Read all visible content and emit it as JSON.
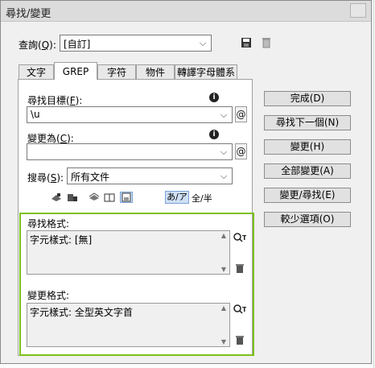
{
  "dialog": {
    "title": "尋找/變更"
  },
  "query": {
    "label": "查詢(",
    "key": "Q",
    "label_end": "):",
    "value": "[自訂]"
  },
  "tabs": [
    "文字",
    "GREP",
    "字符",
    "物件",
    "轉譯字母體系"
  ],
  "find": {
    "label": "尋找目標(",
    "key": "F",
    "label_end": "):",
    "value": "\\u"
  },
  "change": {
    "label": "變更為(",
    "key": "C",
    "label_end": "):",
    "value": ""
  },
  "search": {
    "label": "搜尋(",
    "key": "S",
    "label_end": "):",
    "value": "所有文件"
  },
  "options": {
    "kana": "あ/ア",
    "width": "全/半"
  },
  "find_format": {
    "label": "尋找格式:",
    "value": "字元樣式: [無]"
  },
  "change_format": {
    "label": "變更格式:",
    "value": "字元樣式: 全型英文字首"
  },
  "buttons": {
    "done": "完成(D)",
    "find_next": "尋找下一個(N)",
    "change": "變更(H)",
    "change_all": "全部變更(A)",
    "change_find": "變更/尋找(E)",
    "fewer_options": "較少選項(O)"
  },
  "colors": {
    "highlight": "#7dc11a",
    "selected_option": "#cfe0f5"
  }
}
